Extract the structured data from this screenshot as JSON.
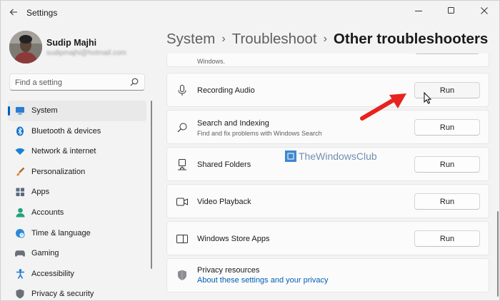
{
  "window": {
    "title": "Settings",
    "back_icon": "arrow-left-icon",
    "controls": [
      "minimize-icon",
      "maximize-icon",
      "close-icon"
    ]
  },
  "profile": {
    "name": "Sudip Majhi",
    "email": "sudipmajhi@hotmail.com"
  },
  "search": {
    "placeholder": "Find a setting",
    "value": ""
  },
  "sidebar": {
    "items": [
      {
        "label": "System",
        "icon": "monitor-icon",
        "active": true
      },
      {
        "label": "Bluetooth & devices",
        "icon": "bluetooth-icon"
      },
      {
        "label": "Network & internet",
        "icon": "wifi-icon"
      },
      {
        "label": "Personalization",
        "icon": "brush-icon"
      },
      {
        "label": "Apps",
        "icon": "apps-icon"
      },
      {
        "label": "Accounts",
        "icon": "person-icon"
      },
      {
        "label": "Time & language",
        "icon": "globe-clock-icon"
      },
      {
        "label": "Gaming",
        "icon": "gamepad-icon"
      },
      {
        "label": "Accessibility",
        "icon": "accessibility-icon"
      },
      {
        "label": "Privacy & security",
        "icon": "shield-icon"
      }
    ]
  },
  "breadcrumb": {
    "parts": [
      "System",
      "Troubleshoot"
    ],
    "separator": "›",
    "current": "Other troubleshooters"
  },
  "troubleshooters": {
    "partial_desc": "Windows.",
    "items": [
      {
        "title": "Recording Audio",
        "desc": "",
        "icon": "microphone-icon",
        "button": "Run"
      },
      {
        "title": "Search and Indexing",
        "desc": "Find and fix problems with Windows Search",
        "icon": "search-icon",
        "button": "Run"
      },
      {
        "title": "Shared Folders",
        "desc": "",
        "icon": "shared-drive-icon",
        "button": "Run"
      },
      {
        "title": "Video Playback",
        "desc": "",
        "icon": "video-icon",
        "button": "Run"
      },
      {
        "title": "Windows Store Apps",
        "desc": "",
        "icon": "store-app-icon",
        "button": "Run"
      }
    ]
  },
  "privacy": {
    "title": "Privacy resources",
    "link": "About these settings and your privacy",
    "icon": "shield-icon"
  },
  "watermark": {
    "text": "TheWindowsClub"
  },
  "colors": {
    "accent": "#005fb8",
    "annotation_arrow": "#e8231f",
    "background": "#f3f3f3",
    "card": "#fbfbfb"
  }
}
